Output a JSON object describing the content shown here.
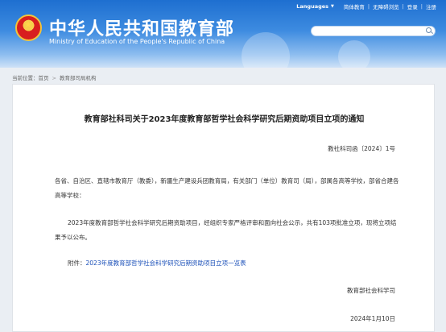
{
  "header": {
    "title": "中华人民共和国教育部",
    "subtitle": "Ministry of Education of the People's Republic of China",
    "nav": {
      "languages": "Languages",
      "links": [
        "简体教育",
        "无障碍浏览",
        "登录",
        "注册"
      ]
    },
    "search": {
      "value": ""
    }
  },
  "breadcrumb": {
    "prefix": "当前位置：",
    "items": [
      "首页",
      "教育部司局机构"
    ]
  },
  "document": {
    "title": "教育部社科司关于2023年度教育部哲学社会科学研究后期资助项目立项的通知",
    "number": "教社科司函〔2024〕1号",
    "paragraph1": "各省、自治区、直辖市教育厅（教委），新疆生产建设兵团教育局，有关部门（单位）教育司（局），部属各高等学校，部省合建各高等学校：",
    "paragraph2": "2023年度教育部哲学社会科学研究后期资助项目，经组织专家严格评审和面向社会公示，共有103项批准立项，现将立项结果予以公布。",
    "attachment_prefix": "附件：",
    "attachment_link": "2023年度教育部哲学社会科学研究后期资助项目立项一览表",
    "signer": "教育部社会科学司",
    "date": "2024年1月10日"
  }
}
